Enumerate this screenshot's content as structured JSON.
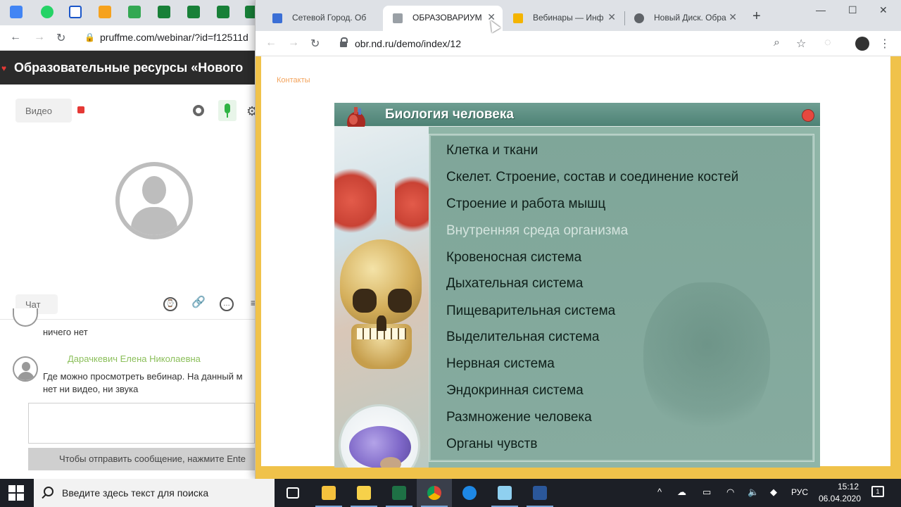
{
  "back_window": {
    "url": "pruffme.com/webinar/?id=f12511d",
    "header_title": "Образовательные ресурсы «Нового",
    "video_label": "Видео",
    "chat_label": "Чат",
    "messages": [
      {
        "lines": [
          "ничего нет"
        ]
      },
      {
        "author": "Дарачкевич Елена Николаевна",
        "lines": [
          "Где можно просмотреть вебинар. На данный м",
          "нет ни видео, ни звука"
        ]
      }
    ],
    "send_hint": "Чтобы отправить сообщение, нажмите Ente"
  },
  "tabs": [
    {
      "label": "Сетевой Город. Об",
      "active": false,
      "favicon_color": "#3b6fd6"
    },
    {
      "label": "ОБРАЗОВАРИУМ",
      "active": true,
      "favicon_color": "#9aa0a6"
    },
    {
      "label": "Вебинары — Инф",
      "active": false,
      "favicon_color": "#f4b400"
    },
    {
      "label": "Новый Диск. Обра",
      "active": false,
      "favicon_color": "#5f6368"
    }
  ],
  "address_bar": {
    "url": "obr.nd.ru/demo/index/12"
  },
  "page": {
    "contacts_link": "Контакты",
    "app": {
      "title": "Биология человека",
      "menu": [
        {
          "label": "Клетка и ткани",
          "dim": false
        },
        {
          "label": "Скелет. Строение, состав и соединение костей",
          "dim": false
        },
        {
          "label": "Строение и работа мышц",
          "dim": false
        },
        {
          "label": "Внутренняя среда организма",
          "dim": true
        },
        {
          "label": "Кровеносная система",
          "dim": false
        },
        {
          "label": "Дыхательная система",
          "dim": false
        },
        {
          "label": "Пищеварительная система",
          "dim": false
        },
        {
          "label": "Выделительная  система",
          "dim": false
        },
        {
          "label": "Нервная  система",
          "dim": false
        },
        {
          "label": "Эндокринная  система",
          "dim": false
        },
        {
          "label": "Размножение человека",
          "dim": false
        },
        {
          "label": "Органы чувств",
          "dim": false
        }
      ]
    }
  },
  "taskbar": {
    "search_placeholder": "Введите здесь текст для поиска",
    "language": "РУС",
    "time": "15:12",
    "date": "06.04.2020",
    "notifications": "1"
  },
  "colors": {
    "page_frame": "#f0c24a",
    "menu_panel": "#86ab9f",
    "app_close": "#e5483f",
    "taskbar": "#1c1f26"
  }
}
